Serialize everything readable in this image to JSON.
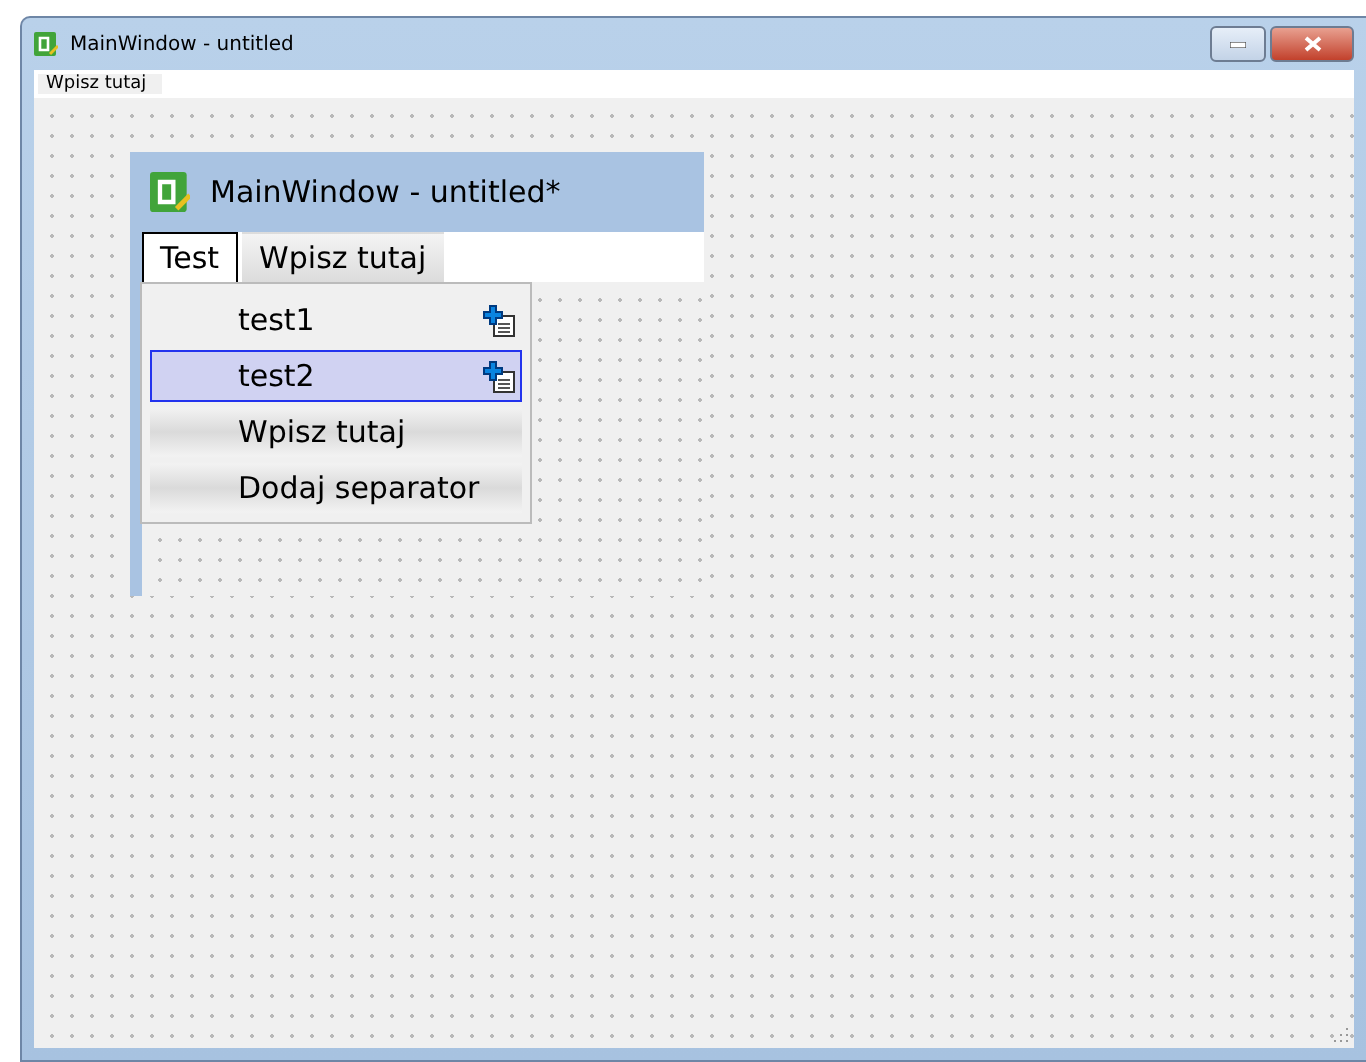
{
  "window": {
    "title": "MainWindow - untitled"
  },
  "menubar": {
    "items": [
      {
        "label": "Wpisz tutaj"
      }
    ]
  },
  "form": {
    "title": "MainWindow - untitled*",
    "menubar": {
      "items": [
        {
          "label": "Test",
          "selected": true
        },
        {
          "label": "Wpisz tutaj",
          "selected": false
        }
      ]
    },
    "menu": {
      "items": [
        {
          "label": "test1",
          "kind": "action",
          "selected": false
        },
        {
          "label": "test2",
          "kind": "action",
          "selected": true
        },
        {
          "label": "Wpisz tutaj",
          "kind": "placeholder",
          "selected": false
        },
        {
          "label": "Dodaj separator",
          "kind": "placeholder",
          "selected": false
        }
      ]
    }
  }
}
